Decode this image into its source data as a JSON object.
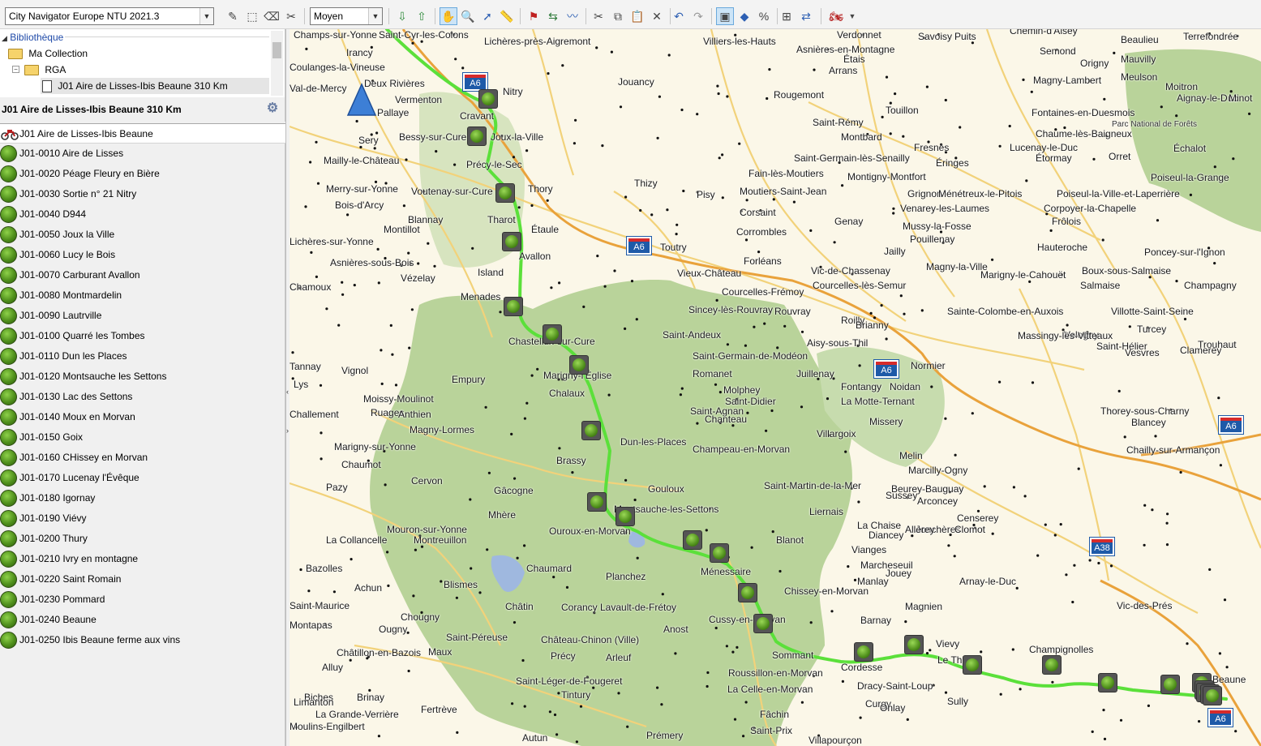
{
  "toolbar": {
    "map_product": "City Navigator Europe NTU 2021.3",
    "detail_level": "Moyen"
  },
  "library": {
    "root": "Bibliothèque",
    "collection": "Ma Collection",
    "folder": "RGA",
    "route_file": "J01 Aire de Lisses-Ibis Beaune 310 Km"
  },
  "route_panel": {
    "title": "J01 Aire de Lisses-Ibis Beaune 310 Km",
    "route_name": "J01 Aire de Lisses-Ibis Beaune",
    "waypoints": [
      "J01-0010 Aire de Lisses",
      "J01-0020 Péage Fleury en Bière",
      "J01-0030 Sortie n° 21 Nitry",
      "J01-0040 D944",
      "J01-0050 Joux la Ville",
      "J01-0060 Lucy le Bois",
      "J01-0070 Carburant Avallon",
      "J01-0080 Montmardelin",
      "J01-0090 Lautrville",
      "J01-0100 Quarré les Tombes",
      "J01-0110 Dun les Places",
      "J01-0120 Montsauche les Settons",
      "J01-0130 Lac des Settons",
      "J01-0140 Moux en Morvan",
      "J01-0150 Goix",
      "J01-0160 CHissey en Morvan",
      "J01-0170 Lucenay l'Évêque",
      "J01-0180 Igornay",
      "J01-0190 Viévy",
      "J01-0200 Thury",
      "J01-0210 Ivry en montagne",
      "J01-0220 Saint Romain",
      "J01-0230 Pommard",
      "J01-0240 Beaune",
      "J01-0250 Ibis Beaune ferme aux vins"
    ]
  },
  "map": {
    "colors": {
      "land": "#fbf7e8",
      "park": "#b9d39a",
      "route": "#5be03a",
      "motorway": "#e9a23b",
      "road": "#f2d27a",
      "water": "#9fb8df"
    },
    "road_shields": [
      "A6",
      "A6",
      "A6",
      "A6",
      "A38",
      "A6"
    ],
    "places": [
      "Champs-sur-Yonne",
      "Saint-Cyr-les-Colons",
      "Lichères-près-Aigremont",
      "Villiers-les-Hauts",
      "Verdonnet",
      "Savoisy",
      "Puits",
      "Chemin-d'Aisey",
      "Beaulieu",
      "Terrefondrée",
      "Irancy",
      "Asnières-en-Montagne",
      "Étais",
      "Semond",
      "Origny",
      "Mauvilly",
      "Coulanges-la-Vineuse",
      "Jouancy",
      "Arrans",
      "Meulson",
      "Magny-Lambert",
      "Moitron",
      "Aignay-le-Duc",
      "Minot",
      "Val-de-Mercy",
      "Deux Rivières",
      "Nitry",
      "Vermenton",
      "Rougemont",
      "Pallaye",
      "Touillon",
      "Fontaines-en-Duesmois",
      "Cravant",
      "Bessy-sur-Cure",
      "Joux-la-Ville",
      "Saint-Rémy",
      "Montbard",
      "Chaume-lès-Baigneux",
      "Parc National de Forêts",
      "Sery",
      "Fresnes",
      "Lucenay-le-Duc",
      "Échalot",
      "Mailly-le-Château",
      "Précy-le-Sec",
      "Saint-Germain-lès-Senailly",
      "Étormay",
      "Orret",
      "Thizy",
      "Fain-lès-Moutiers",
      "Montigny-Montfort",
      "Éringes",
      "Poiseul-la-Grange",
      "Merry-sur-Yonne",
      "Voutenay-sur-Cure",
      "Thory",
      "Pisy",
      "Moutiers-Saint-Jean",
      "Grignon",
      "Ménétreux-le-Pitois",
      "Poiseul-la-Ville-et-Laperrière",
      "Bois-d'Arcy",
      "Venarey-les-Laumes",
      "Corpoyer-la-Chapelle",
      "Blannay",
      "Tharot",
      "Corsaint",
      "Frôlois",
      "Montillot",
      "Étaule",
      "Genay",
      "Corrombles",
      "Mussy-la-Fosse",
      "Lichères-sur-Yonne",
      "Pouillenay",
      "Hauteroche",
      "Toutry",
      "Jailly",
      "Poncey-sur-l'Ignon",
      "Avallon",
      "Forléans",
      "Magny-la-Ville",
      "Asnières-sous-Bois",
      "Vic-de-Chassenay",
      "Boux-sous-Salmaise",
      "Island",
      "Vieux-Château",
      "Marigny-le-Cahouët",
      "Champagny",
      "Chamoux",
      "Vézelay",
      "Courcelles-Frémoy",
      "Courcelles-lès-Semur",
      "Salmaise",
      "Menades",
      "Sincey-lès-Rouvray",
      "Sainte-Colombe-en-Auxois",
      "Villotte-Saint-Seine",
      "Rouvray",
      "Roilly",
      "Brianny",
      "Turcey",
      "Velogny",
      "Massingy-lès-Vitteaux",
      "Chastellux-sur-Cure",
      "Saint-Andeux",
      "Aisy-sous-Thil",
      "Trouhaut",
      "Saint-Hélier",
      "Clamerey",
      "Vesvres",
      "Tannay",
      "Saint-Germain-de-Modéon",
      "Vignol",
      "Normier",
      "Romanet",
      "Juillenay",
      "Marigny-l'Église",
      "Empury",
      "Lys",
      "Fontangy",
      "Noidan",
      "Molphey",
      "Chalaux",
      "Moissy-Moulinot",
      "Saint-Didier",
      "La Motte-Ternant",
      "Thorey-sous-Charny",
      "Ruages",
      "Saint-Agnan",
      "Anthien",
      "Challement",
      "Chanteau",
      "Missery",
      "Blancey",
      "Magny-Lormes",
      "Villargoix",
      "Dun-les-Places",
      "Marigny-sur-Yonne",
      "Champeau-en-Morvan",
      "Chailly-sur-Armançon",
      "Brassy",
      "Melin",
      "Chaumot",
      "Marcilly-Ogny",
      "Cervon",
      "Saint-Martin-de-la-Mer",
      "Pazy",
      "Gouloux",
      "Beurey-Bauguay",
      "Gâcogne",
      "Sussey",
      "Arconcey",
      "Montsauche-les-Settons",
      "Liernais",
      "Censerey",
      "La Chaise",
      "Jonchères",
      "Mhère",
      "Allerey",
      "Clomot",
      "Mouron-sur-Yonne",
      "Ouroux-en-Morvan",
      "Diancey",
      "Montreuillon",
      "La Collancelle",
      "Blanot",
      "Vianges",
      "Chaumard",
      "Bazolles",
      "Marcheseuil",
      "Ménessaire",
      "Jouey",
      "Blismes",
      "Manlay",
      "Planchez",
      "Achun",
      "Arnay-le-Duc",
      "Chissey-en-Morvan",
      "Corancy",
      "Lavault-de-Frétoy",
      "Magnien",
      "Vic-des-Prés",
      "Saint-Maurice",
      "Châtin",
      "Chougny",
      "Cussy-en-Morvan",
      "Barnay",
      "Montapas",
      "Anost",
      "Ougny",
      "Saint-Péreuse",
      "Château-Chinon (Ville)",
      "Vievy",
      "Champignolles",
      "Châtillon-en-Bazois",
      "Maux",
      "Sommant",
      "Le Thillot",
      "Précy",
      "Arleuf",
      "Alluy",
      "Cordesse",
      "Beaune",
      "Roussillon-en-Morvan",
      "Saint-Léger-de-Fougeret",
      "Dracy-Saint-Loup",
      "La Celle-en-Morvan",
      "Biches",
      "Brinay",
      "Sully",
      "Fâchin",
      "Tintury",
      "Limanton",
      "Curgy",
      "Moulins-Engilbert",
      "Fertrève",
      "Onlay",
      "La Grande-Verrière",
      "Autun",
      "Saint-Prix",
      "Villapourçon",
      "Prémery"
    ]
  }
}
